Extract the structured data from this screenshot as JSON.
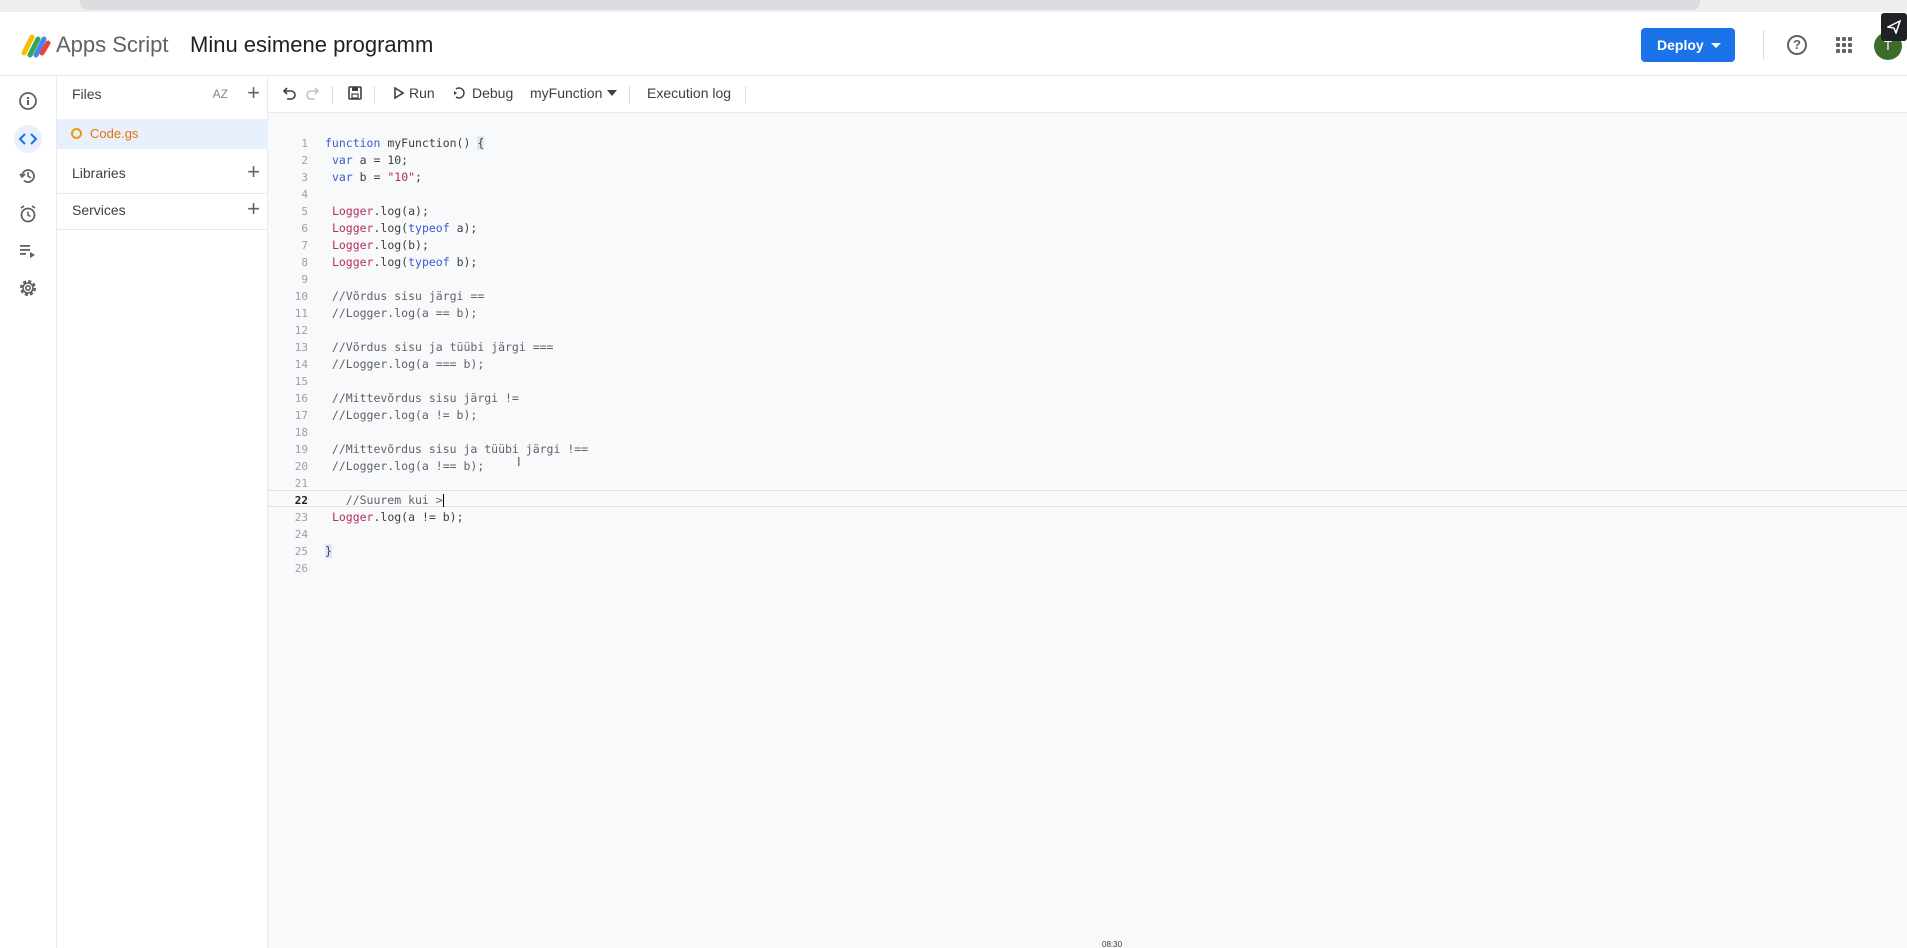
{
  "header": {
    "app_name": "Apps Script",
    "project_title": "Minu esimene programm",
    "deploy_label": "Deploy",
    "avatar_initial": "T"
  },
  "files_panel": {
    "files_label": "Files",
    "sort_label": "AZ",
    "file_name": "Code.gs",
    "libraries_label": "Libraries",
    "services_label": "Services"
  },
  "toolbar": {
    "run_label": "Run",
    "debug_label": "Debug",
    "function_selector": "myFunction",
    "execution_log_label": "Execution log"
  },
  "editor": {
    "active_line": 22,
    "lines": [
      "function myFunction() {",
      " var a = 10;",
      " var b = \"10\";",
      "",
      " Logger.log(a);",
      " Logger.log(typeof a);",
      " Logger.log(b);",
      " Logger.log(typeof b);",
      "",
      " //Võrdus sisu järgi ==",
      " //Logger.log(a == b);",
      "",
      " //Võrdus sisu ja tüübi järgi ===",
      " //Logger.log(a === b);",
      "",
      " //Mittevõrdus sisu järgi !=",
      " //Logger.log(a != b);",
      "",
      " //Mittevõrdus sisu ja tüübi järgi !==",
      " //Logger.log(a !== b);",
      "",
      "   //Suurem kui >",
      " Logger.log(a != b);",
      "",
      "}",
      ""
    ]
  },
  "video_timestamp": "08:30",
  "colors": {
    "accent": "#1a73e8",
    "keyword": "#3b5bcc",
    "logger": "#b03060",
    "file_icon": "#f29900"
  }
}
